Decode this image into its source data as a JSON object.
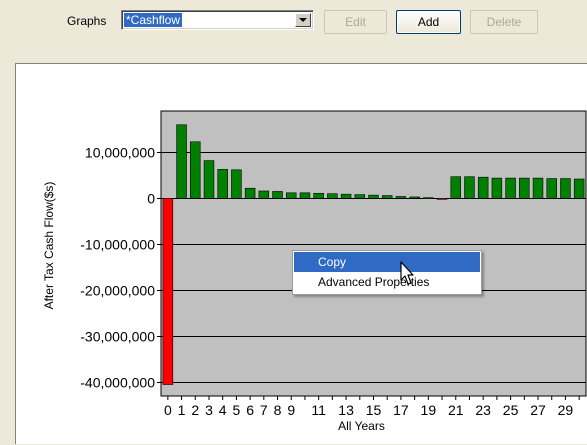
{
  "toolbar": {
    "graphs_label": "Graphs",
    "selected_graph": "*Cashflow",
    "edit_label": "Edit",
    "add_label": "Add",
    "delete_label": "Delete"
  },
  "context_menu": {
    "items": [
      {
        "label": "Copy",
        "highlighted": true
      },
      {
        "label": "Advanced Properties",
        "highlighted": false
      }
    ]
  },
  "colors": {
    "positive_bar": "#008000",
    "negative_bar": "#ff0000",
    "plot_background": "#c0c0c0",
    "highlight": "#316ac5"
  },
  "chart_data": {
    "type": "bar",
    "xlabel": "All Years",
    "ylabel": "After Tax Cash Flow($s)",
    "ylim": [
      -43000000,
      19000000
    ],
    "yticks": [
      10000000,
      0,
      -10000000,
      -20000000,
      -30000000,
      -40000000
    ],
    "ytick_labels": [
      "10,000,000",
      "0",
      "-10,000,000",
      "-20,000,000",
      "-30,000,000",
      "-40,000,000"
    ],
    "grid": true,
    "categories": [
      0,
      1,
      2,
      3,
      4,
      5,
      6,
      7,
      8,
      9,
      10,
      11,
      12,
      13,
      14,
      15,
      16,
      17,
      18,
      19,
      20,
      21,
      22,
      23,
      24,
      25,
      26,
      27,
      28,
      29,
      30
    ],
    "xtick_labels": [
      "0",
      "1",
      "2",
      "3",
      "4",
      "5",
      "6",
      "7",
      "8",
      "9",
      "",
      "11",
      "",
      "13",
      "",
      "15",
      "",
      "17",
      "",
      "19",
      "",
      "21",
      "",
      "23",
      "",
      "25",
      "",
      "27",
      "",
      "29",
      ""
    ],
    "values": [
      -40500000,
      16000000,
      12300000,
      8200000,
      6300000,
      6200000,
      2200000,
      1600000,
      1500000,
      1200000,
      1200000,
      1100000,
      1000000,
      900000,
      800000,
      700000,
      600000,
      400000,
      300000,
      150000,
      -200000,
      4700000,
      4700000,
      4600000,
      4400000,
      4400000,
      4400000,
      4400000,
      4300000,
      4300000,
      4200000
    ]
  }
}
